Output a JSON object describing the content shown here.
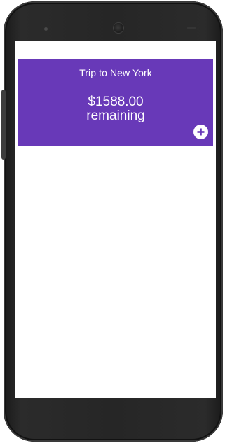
{
  "budget_card": {
    "title": "Trip to New York",
    "amount": "$1588.00",
    "remaining_label": "remaining",
    "add_icon": "plus-circle-icon"
  },
  "colors": {
    "card_background": "#6839b8",
    "card_text": "#ffffff",
    "screen_background": "#ffffff",
    "phone_body": "#262626"
  }
}
